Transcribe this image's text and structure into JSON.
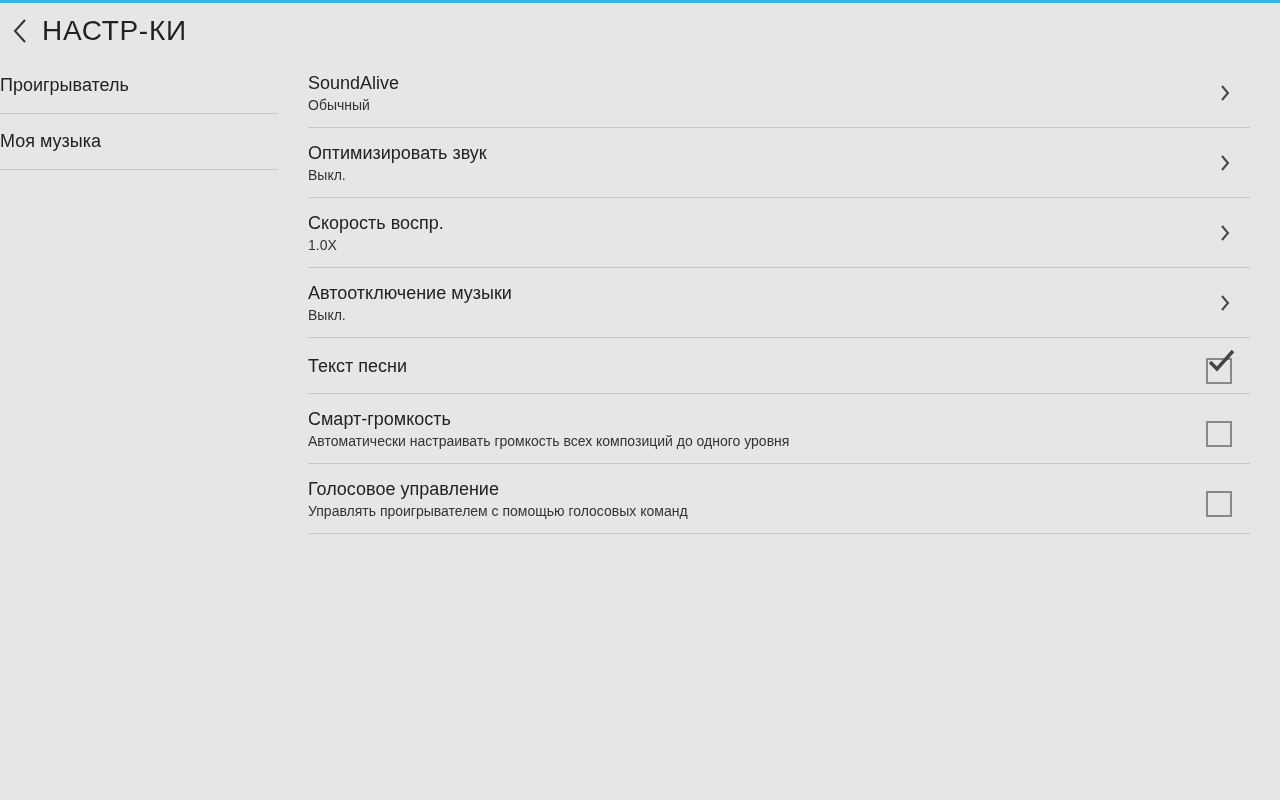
{
  "header": {
    "title": "НАСТР-КИ"
  },
  "sidebar": {
    "items": [
      {
        "label": "Проигрыватель"
      },
      {
        "label": "Моя музыка"
      }
    ]
  },
  "settings": [
    {
      "kind": "nav",
      "title": "SoundAlive",
      "subtitle": "Обычный"
    },
    {
      "kind": "nav",
      "title": "Оптимизировать звук",
      "subtitle": "Выкл."
    },
    {
      "kind": "nav",
      "title": "Скорость воспр.",
      "subtitle": "1.0X"
    },
    {
      "kind": "nav",
      "title": "Автоотключение музыки",
      "subtitle": "Выкл."
    },
    {
      "kind": "check",
      "title": "Текст песни",
      "checked": true
    },
    {
      "kind": "check",
      "title": "Смарт-громкость",
      "subtitle": "Автоматически настраивать громкость всех композиций до одного уровня",
      "checked": false
    },
    {
      "kind": "check",
      "title": "Голосовое управление",
      "subtitle": "Управлять проигрывателем с помощью голосовых команд",
      "checked": false
    }
  ]
}
